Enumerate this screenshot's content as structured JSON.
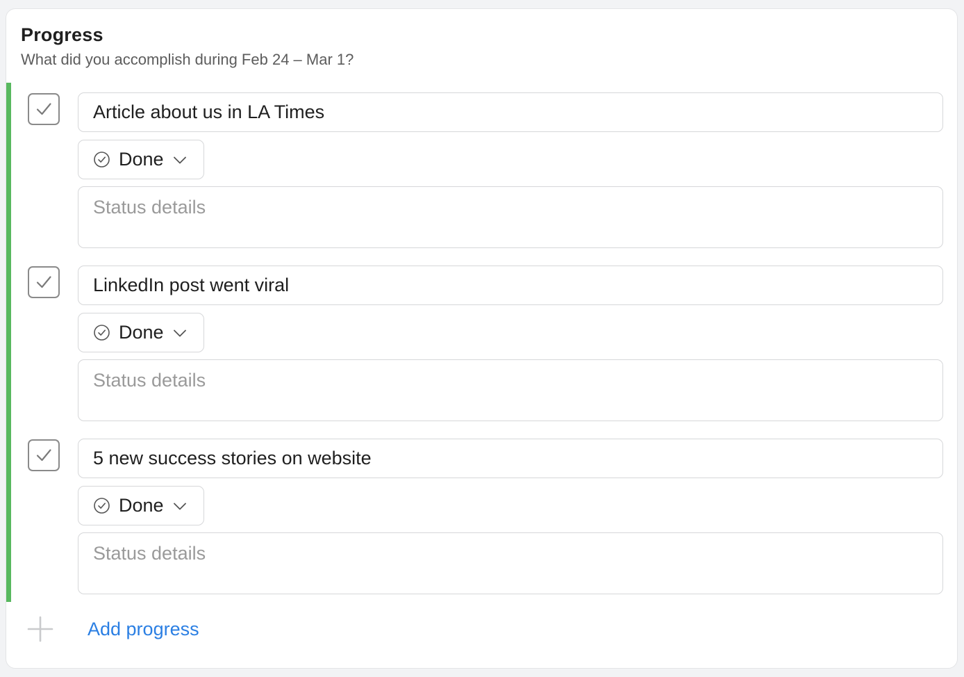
{
  "header": {
    "title": "Progress",
    "subtitle": "What did you accomplish during Feb 24 – Mar 1?"
  },
  "items": [
    {
      "title": "Article about us in LA Times",
      "checked": true,
      "status": "Done",
      "details_placeholder": "Status details"
    },
    {
      "title": "LinkedIn post went viral",
      "checked": true,
      "status": "Done",
      "details_placeholder": "Status details"
    },
    {
      "title": "5 new success stories on website",
      "checked": true,
      "status": "Done",
      "details_placeholder": "Status details"
    }
  ],
  "add_label": "Add progress",
  "icons": {
    "checkbox": "checkmark-icon",
    "status": "check-circle-icon",
    "dropdown": "chevron-down-icon",
    "add": "plus-icon"
  },
  "colors": {
    "accent": "#58b85f",
    "link": "#2b7fe3",
    "border": "#d6d7d9",
    "placeholder": "#9a9a9a"
  }
}
